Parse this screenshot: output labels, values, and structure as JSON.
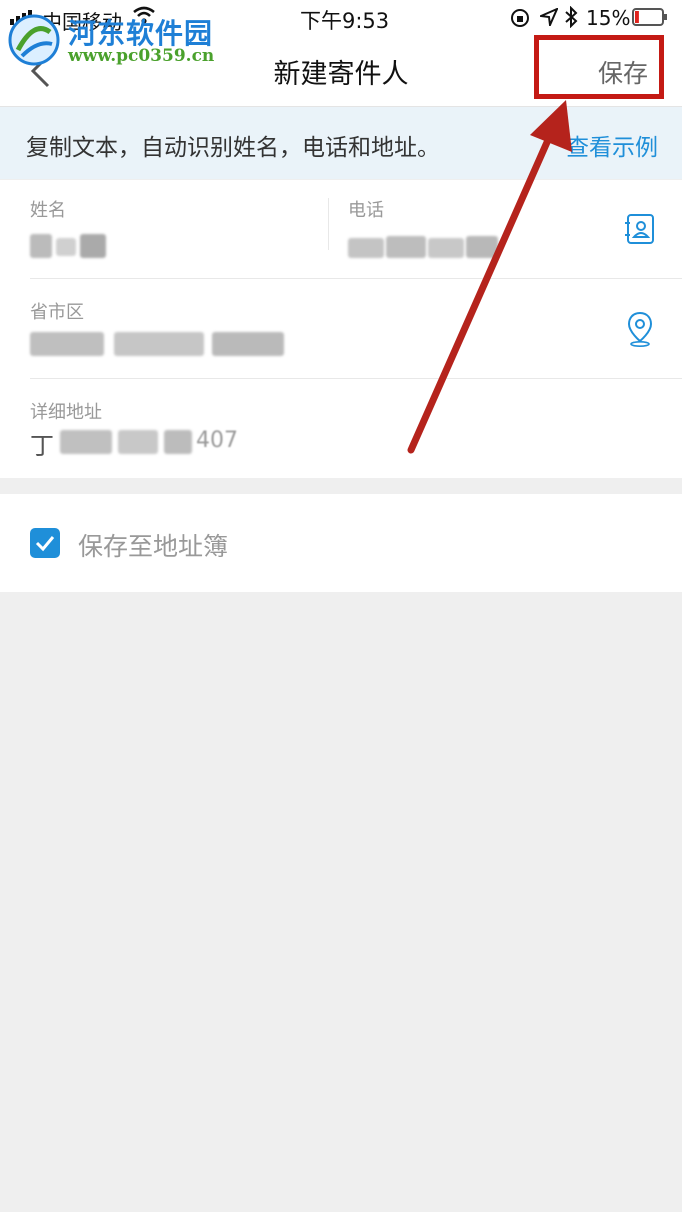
{
  "status_bar": {
    "carrier": "中国移动",
    "time": "下午9:53",
    "battery_pct": "15%",
    "battery_level": 0.15
  },
  "watermark": {
    "title": "河东软件园",
    "url": "www.pc0359.cn"
  },
  "nav": {
    "title": "新建寄件人",
    "save_label": "保存"
  },
  "info_bar": {
    "text": "复制文本，自动识别姓名，电话和地址。",
    "link_label": "查看示例"
  },
  "form": {
    "name_label": "姓名",
    "phone_label": "电话",
    "region_label": "省市区",
    "address_label": "详细地址",
    "address_value_visible": "丁",
    "address_value_tail": "407"
  },
  "address_book": {
    "checked": true,
    "label": "保存至地址簿"
  },
  "colors": {
    "accent": "#1f8fd9",
    "highlight": "#c41a14",
    "arrow": "#b5231c"
  },
  "icons": [
    "back-icon",
    "contact-card-icon",
    "location-pin-icon",
    "check-icon",
    "wifi-icon",
    "signal-icon",
    "battery-icon",
    "bluetooth-icon",
    "location-arrow-icon",
    "lock-rotation-icon"
  ]
}
